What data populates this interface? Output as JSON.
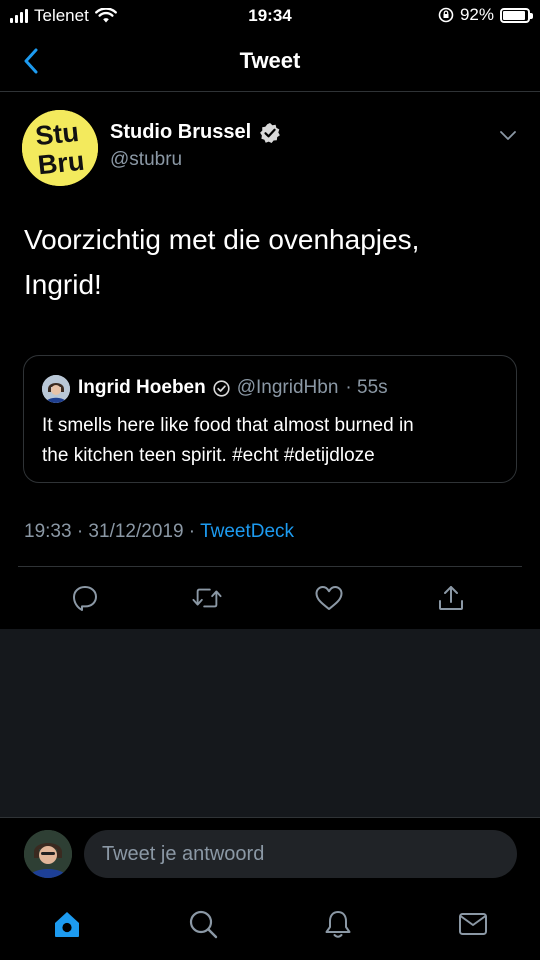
{
  "status_bar": {
    "carrier": "Telenet",
    "time": "19:34",
    "battery": "92%",
    "battery_level": 0.92
  },
  "nav": {
    "title": "Tweet"
  },
  "tweet": {
    "author_name": "Studio Brussel",
    "author_handle": "@stubru",
    "avatar_text": [
      "Stu",
      "Bru"
    ],
    "text_lines": [
      "Voorzichtig met die ovenhapjes,",
      "Ingrid!"
    ],
    "quote": {
      "author_name": "Ingrid Hoeben",
      "author_handle": "@IngridHbn",
      "age": "· 55s",
      "text_lines": [
        "It smells here like food that almost burned in",
        "the kitchen teen spirit. #echt #detijdloze"
      ]
    },
    "timestamp": "19:33 · 31/12/2019 · ",
    "source": "TweetDeck"
  },
  "reply": {
    "placeholder": "Tweet je antwoord"
  },
  "icons": {
    "back": "chevron-left-icon",
    "verified": "verified-badge-icon",
    "more": "chevron-down-icon",
    "reply": "reply-icon",
    "retweet": "retweet-icon",
    "like": "heart-icon",
    "share": "share-icon",
    "home": "home-icon",
    "search": "search-icon",
    "notifications": "bell-icon",
    "messages": "mail-icon"
  },
  "colors": {
    "accent": "#1d9bf0",
    "background": "#000000",
    "muted": "#8b98a5",
    "brand_yellow": "#f3ea5d"
  }
}
